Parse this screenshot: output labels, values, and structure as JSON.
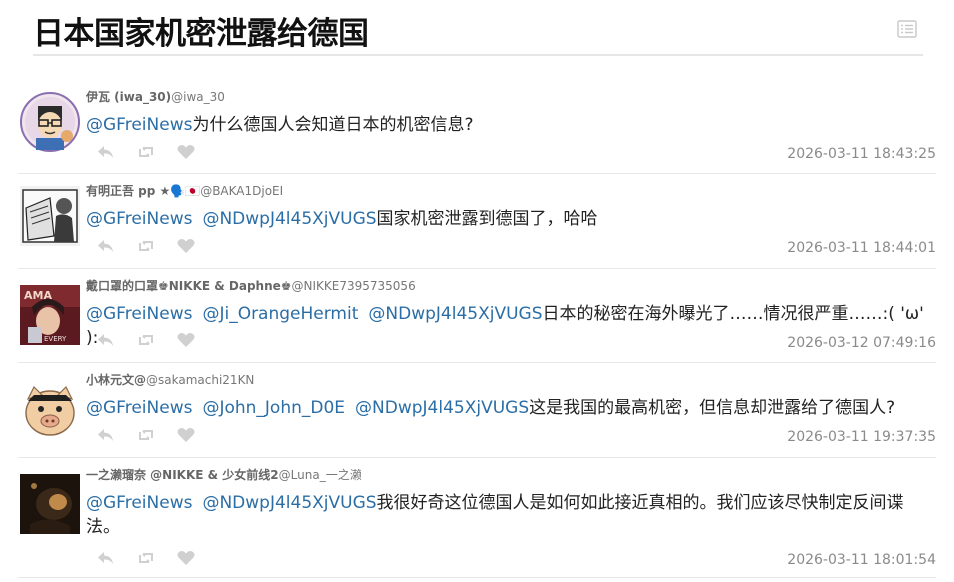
{
  "page": {
    "title": "日本国家机密泄露给德国",
    "list_icon": "list-icon"
  },
  "tweets": [
    {
      "author": "伊瓦 (iwa_30)",
      "handle": "@iwa_30",
      "mentions": [
        "@GFreiNews"
      ],
      "text": "为什么德国人会知道日本的机密信息?",
      "time": "2026-03-11 18:43:25"
    },
    {
      "author": "有明正吾 pp ★🗣️🇯🇵",
      "handle": "@BAKA1DjoEI",
      "mentions": [
        "@GFreiNews",
        "@NDwpJ4l45XjVUGS"
      ],
      "text": "国家机密泄露到德国了，哈哈",
      "time": "2026-03-11 18:44:01"
    },
    {
      "author": "戴口罩的口罩♚NIKKE & Daphne♚",
      "handle": "@NIKKE7395735056",
      "mentions": [
        "@GFreiNews",
        "@Ji_OrangeHermit",
        "@NDwpJ4l45XjVUGS"
      ],
      "text": "日本的秘密在海外曝光了……情况很严重……:( 'ω' ):",
      "time": "2026-03-12 07:49:16"
    },
    {
      "author": "小林元文@",
      "handle": "@sakamachi21KN",
      "mentions": [
        "@GFreiNews",
        "@John_John_D0E",
        "@NDwpJ4l45XjVUGS"
      ],
      "text": "这是我国的最高机密，但信息却泄露给了德国人?",
      "time": "2026-03-11 19:37:35"
    },
    {
      "author": "一之濑瑠奈 @NIKKE & 少女前线2",
      "handle": "@Luna_一之濑",
      "mentions": [
        "@GFreiNews",
        "@NDwpJ4l45XjVUGS"
      ],
      "text": "我很好奇这位德国人是如何如此接近真相的。我们应该尽快制定反间谍法。",
      "time": "2026-03-11 18:01:54"
    }
  ],
  "action_icons": [
    "reply-icon",
    "retweet-icon",
    "like-icon"
  ],
  "colors": {
    "mention": "#2b6ea6",
    "muted": "#8a8a8a",
    "icon": "#cfcfcf",
    "divider": "#e8e8e8"
  }
}
